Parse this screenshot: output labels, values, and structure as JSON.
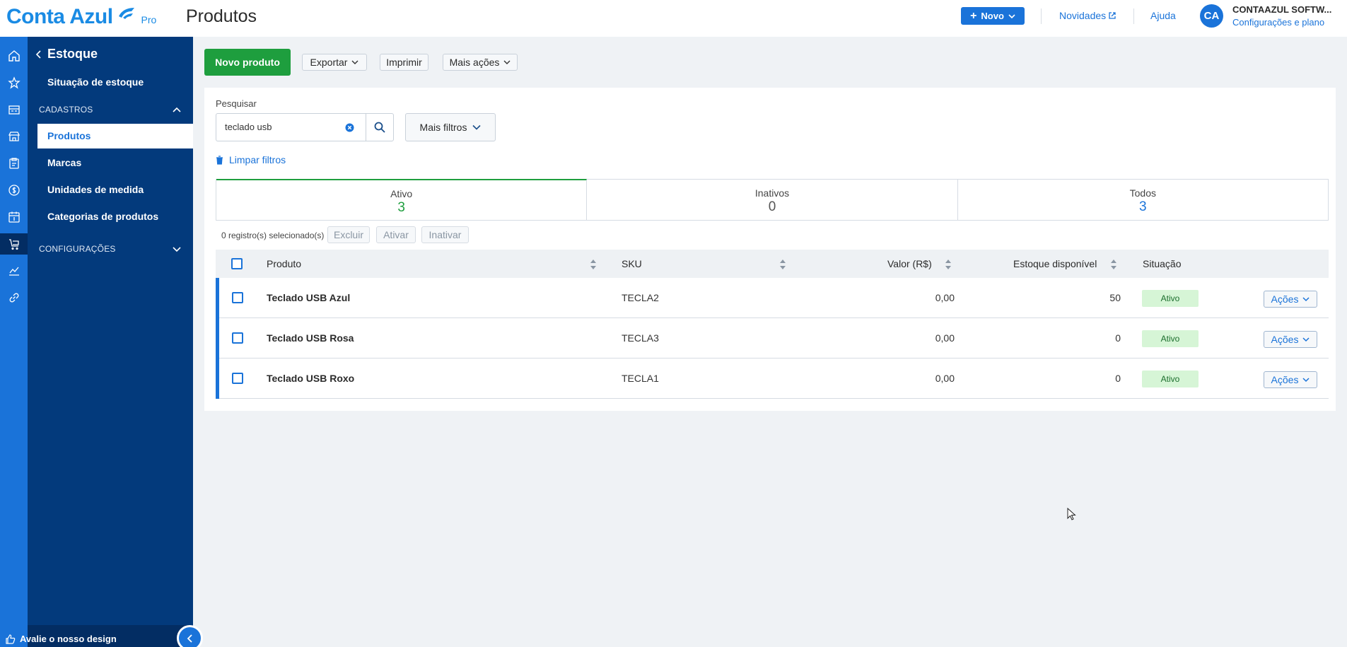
{
  "app": {
    "logo_text": "Conta Azul",
    "logo_badge": "Pro",
    "page_title": "Produtos"
  },
  "header": {
    "new_button": "Novo",
    "novidades": "Novidades",
    "ajuda": "Ajuda",
    "avatar_initials": "CA",
    "company_name": "CONTAAZUL SOFTW...",
    "company_sub": "Configurações e plano"
  },
  "sidebar": {
    "back_label": "Estoque",
    "items": [
      {
        "label": "Situação de estoque"
      },
      {
        "label": "Produtos"
      },
      {
        "label": "Marcas"
      },
      {
        "label": "Unidades de medida"
      },
      {
        "label": "Categorias de produtos"
      }
    ],
    "section_cadastros": "CADASTROS",
    "section_configuracoes": "CONFIGURAÇÕES",
    "feedback": "Avalie o nosso design"
  },
  "toolbar": {
    "new_product": "Novo produto",
    "export": "Exportar",
    "print": "Imprimir",
    "more_actions": "Mais ações"
  },
  "search": {
    "label": "Pesquisar",
    "value": "teclado usb",
    "more_filters": "Mais filtros",
    "clear_filters": "Limpar filtros"
  },
  "tabs": [
    {
      "label": "Ativo",
      "count": "3",
      "color": "#1e9e3e"
    },
    {
      "label": "Inativos",
      "count": "0",
      "color": "#555555"
    },
    {
      "label": "Todos",
      "count": "3",
      "color": "#1a73d9"
    }
  ],
  "bulk": {
    "selected_text": "0 registro(s) selecionado(s)",
    "delete": "Excluir",
    "activate": "Ativar",
    "deactivate": "Inativar"
  },
  "table": {
    "headers": {
      "product": "Produto",
      "sku": "SKU",
      "value": "Valor (R$)",
      "stock": "Estoque disponível",
      "status": "Situação"
    },
    "rows": [
      {
        "name": "Teclado USB Azul",
        "sku": "TECLA2",
        "value": "0,00",
        "stock": "50",
        "status": "Ativo",
        "actions": "Ações"
      },
      {
        "name": "Teclado USB Rosa",
        "sku": "TECLA3",
        "value": "0,00",
        "stock": "0",
        "status": "Ativo",
        "actions": "Ações"
      },
      {
        "name": "Teclado USB Roxo",
        "sku": "TECLA1",
        "value": "0,00",
        "stock": "0",
        "status": "Ativo",
        "actions": "Ações"
      }
    ]
  },
  "colors": {
    "brand_blue": "#1a73d9",
    "sidebar_bg": "#033a7c",
    "success_green": "#1e9e3e"
  }
}
